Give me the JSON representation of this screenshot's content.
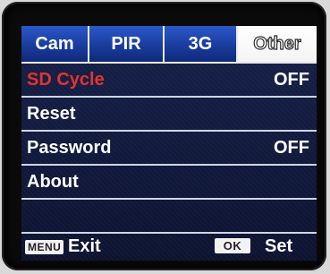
{
  "tabs": [
    {
      "label": "Cam",
      "active": false
    },
    {
      "label": "PIR",
      "active": false
    },
    {
      "label": "3G",
      "active": false
    },
    {
      "label": "Other",
      "active": true
    }
  ],
  "items": [
    {
      "label": "SD Cycle",
      "value": "OFF",
      "selected": true
    },
    {
      "label": "Reset",
      "value": ""
    },
    {
      "label": "Password",
      "value": "OFF"
    },
    {
      "label": "About",
      "value": ""
    },
    {
      "label": "",
      "value": ""
    }
  ],
  "footer": {
    "menu_key": "MENU",
    "menu_action": "Exit",
    "ok_key": "OK",
    "ok_action": "Set"
  },
  "colors": {
    "selected_text": "#e3342f",
    "tab_blue": "#1a3c9e",
    "background": "#0d1630"
  }
}
